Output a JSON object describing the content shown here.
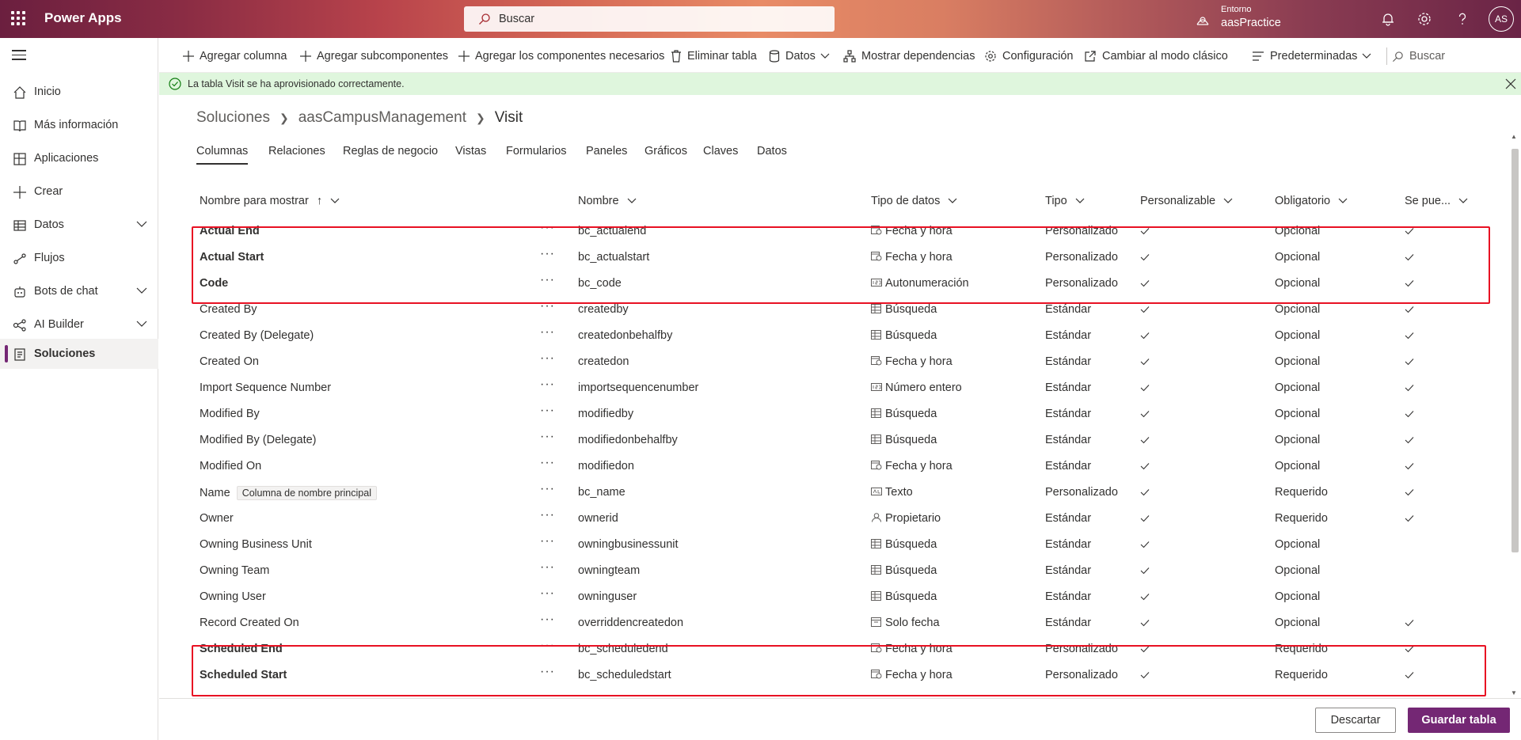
{
  "header": {
    "app_name": "Power Apps",
    "search_placeholder": "Buscar",
    "environment_label": "Entorno",
    "environment_name": "aasPractice",
    "avatar_initials": "AS"
  },
  "nav": {
    "items": [
      {
        "label": "Inicio",
        "icon": "home-icon"
      },
      {
        "label": "Más información",
        "icon": "book-icon"
      },
      {
        "label": "Aplicaciones",
        "icon": "apps-icon"
      },
      {
        "label": "Crear",
        "icon": "plus-icon"
      },
      {
        "label": "Datos",
        "icon": "table-icon"
      },
      {
        "label": "Flujos",
        "icon": "flow-icon"
      },
      {
        "label": "Bots de chat",
        "icon": "bot-icon"
      },
      {
        "label": "AI Builder",
        "icon": "ai-builder-icon"
      },
      {
        "label": "Soluciones",
        "icon": "solutions-icon"
      }
    ]
  },
  "commands": {
    "add_column": "Agregar columna",
    "add_subcomponents": "Agregar subcomponentes",
    "add_required": "Agregar los componentes necesarios",
    "delete_table": "Eliminar tabla",
    "data": "Datos",
    "show_dependencies": "Mostrar dependencias",
    "settings": "Configuración",
    "classic_mode": "Cambiar al modo clásico",
    "view_selector": "Predeterminadas",
    "search": "Buscar"
  },
  "message": {
    "text": "La tabla Visit se ha aprovisionado correctamente."
  },
  "breadcrumb": {
    "root": "Soluciones",
    "solution": "aasCampusManagement",
    "current": "Visit"
  },
  "tabs": [
    "Columnas",
    "Relaciones",
    "Reglas de negocio",
    "Vistas",
    "Formularios",
    "Paneles",
    "Gráficos",
    "Claves",
    "Datos"
  ],
  "table": {
    "headers": {
      "display_name": "Nombre para mostrar",
      "sort_indicator": "↑",
      "name": "Nombre",
      "data_type": "Tipo de datos",
      "type": "Tipo",
      "customizable": "Personalizable",
      "required": "Obligatorio",
      "searchable": "Se pue..."
    },
    "more_actions": "···",
    "primary_badge": "Columna de nombre principal",
    "rows": [
      {
        "display": "Actual End",
        "name": "bc_actualend",
        "dtype": "Fecha y hora",
        "dicon": "datetime-icon",
        "type": "Personalizado",
        "required": "Opcional",
        "searchable": true,
        "bold": true
      },
      {
        "display": "Actual Start",
        "name": "bc_actualstart",
        "dtype": "Fecha y hora",
        "dicon": "datetime-icon",
        "type": "Personalizado",
        "required": "Opcional",
        "searchable": true,
        "bold": true
      },
      {
        "display": "Code",
        "name": "bc_code",
        "dtype": "Autonumeración",
        "dicon": "autonumber-icon",
        "type": "Personalizado",
        "required": "Opcional",
        "searchable": true,
        "bold": true
      },
      {
        "display": "Created By",
        "name": "createdby",
        "dtype": "Búsqueda",
        "dicon": "lookup-icon",
        "type": "Estándar",
        "required": "Opcional",
        "searchable": true,
        "bold": false
      },
      {
        "display": "Created By (Delegate)",
        "name": "createdonbehalfby",
        "dtype": "Búsqueda",
        "dicon": "lookup-icon",
        "type": "Estándar",
        "required": "Opcional",
        "searchable": true,
        "bold": false
      },
      {
        "display": "Created On",
        "name": "createdon",
        "dtype": "Fecha y hora",
        "dicon": "datetime-icon",
        "type": "Estándar",
        "required": "Opcional",
        "searchable": true,
        "bold": false
      },
      {
        "display": "Import Sequence Number",
        "name": "importsequencenumber",
        "dtype": "Número entero",
        "dicon": "number-icon",
        "type": "Estándar",
        "required": "Opcional",
        "searchable": true,
        "bold": false
      },
      {
        "display": "Modified By",
        "name": "modifiedby",
        "dtype": "Búsqueda",
        "dicon": "lookup-icon",
        "type": "Estándar",
        "required": "Opcional",
        "searchable": true,
        "bold": false
      },
      {
        "display": "Modified By (Delegate)",
        "name": "modifiedonbehalfby",
        "dtype": "Búsqueda",
        "dicon": "lookup-icon",
        "type": "Estándar",
        "required": "Opcional",
        "searchable": true,
        "bold": false
      },
      {
        "display": "Modified On",
        "name": "modifiedon",
        "dtype": "Fecha y hora",
        "dicon": "datetime-icon",
        "type": "Estándar",
        "required": "Opcional",
        "searchable": true,
        "bold": false
      },
      {
        "display": "Name",
        "name": "bc_name",
        "dtype": "Texto",
        "dicon": "text-icon",
        "type": "Personalizado",
        "required": "Requerido",
        "searchable": true,
        "bold": false,
        "primary": true
      },
      {
        "display": "Owner",
        "name": "ownerid",
        "dtype": "Propietario",
        "dicon": "owner-icon",
        "type": "Estándar",
        "required": "Requerido",
        "searchable": true,
        "bold": false
      },
      {
        "display": "Owning Business Unit",
        "name": "owningbusinessunit",
        "dtype": "Búsqueda",
        "dicon": "lookup-icon",
        "type": "Estándar",
        "required": "Opcional",
        "searchable": false,
        "bold": false
      },
      {
        "display": "Owning Team",
        "name": "owningteam",
        "dtype": "Búsqueda",
        "dicon": "lookup-icon",
        "type": "Estándar",
        "required": "Opcional",
        "searchable": false,
        "bold": false
      },
      {
        "display": "Owning User",
        "name": "owninguser",
        "dtype": "Búsqueda",
        "dicon": "lookup-icon",
        "type": "Estándar",
        "required": "Opcional",
        "searchable": false,
        "bold": false
      },
      {
        "display": "Record Created On",
        "name": "overriddencreatedon",
        "dtype": "Solo fecha",
        "dicon": "date-icon",
        "type": "Estándar",
        "required": "Opcional",
        "searchable": true,
        "bold": false
      },
      {
        "display": "Scheduled End",
        "name": "bc_scheduledend",
        "dtype": "Fecha y hora",
        "dicon": "datetime-icon",
        "type": "Personalizado",
        "required": "Requerido",
        "searchable": true,
        "bold": true
      },
      {
        "display": "Scheduled Start",
        "name": "bc_scheduledstart",
        "dtype": "Fecha y hora",
        "dicon": "datetime-icon",
        "type": "Personalizado",
        "required": "Requerido",
        "searchable": true,
        "bold": true
      }
    ]
  },
  "footer": {
    "discard": "Descartar",
    "save": "Guardar tabla"
  },
  "colors": {
    "accent": "#742774",
    "success_bg": "#dff6dd",
    "highlight": "#e81123"
  }
}
